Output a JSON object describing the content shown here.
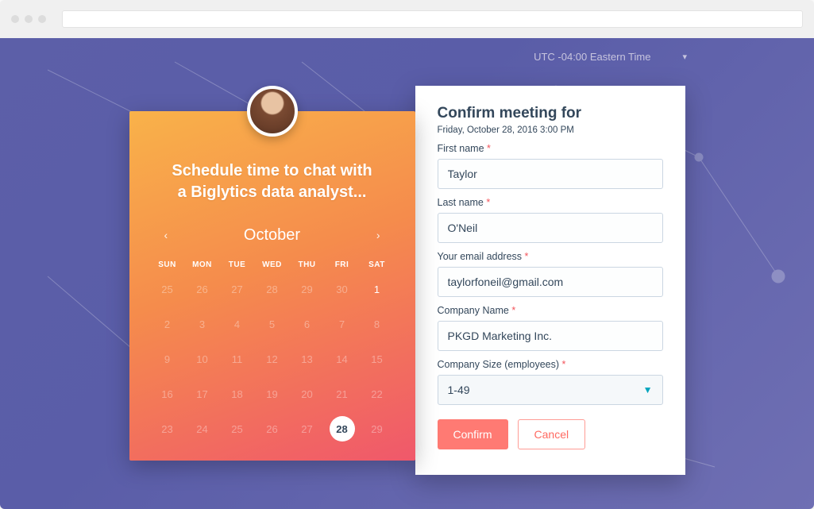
{
  "timezone": {
    "label": "UTC -04:00 Eastern Time"
  },
  "calendar": {
    "title_line1": "Schedule time to chat with",
    "title_line2": "a Biglytics data analyst...",
    "month": "October",
    "dow": [
      "SUN",
      "MON",
      "TUE",
      "WED",
      "THU",
      "FRI",
      "SAT"
    ],
    "selected_day": "28",
    "weeks": [
      [
        {
          "n": "25",
          "dim": true
        },
        {
          "n": "26",
          "dim": true
        },
        {
          "n": "27",
          "dim": true
        },
        {
          "n": "28",
          "dim": true
        },
        {
          "n": "29",
          "dim": true
        },
        {
          "n": "30",
          "dim": true
        },
        {
          "n": "1",
          "dim": false
        }
      ],
      [
        {
          "n": "2",
          "dim": true
        },
        {
          "n": "3",
          "dim": true
        },
        {
          "n": "4",
          "dim": true
        },
        {
          "n": "5",
          "dim": true
        },
        {
          "n": "6",
          "dim": true
        },
        {
          "n": "7",
          "dim": true
        },
        {
          "n": "8",
          "dim": true
        }
      ],
      [
        {
          "n": "9",
          "dim": true
        },
        {
          "n": "10",
          "dim": true
        },
        {
          "n": "11",
          "dim": true
        },
        {
          "n": "12",
          "dim": true
        },
        {
          "n": "13",
          "dim": true
        },
        {
          "n": "14",
          "dim": true
        },
        {
          "n": "15",
          "dim": true
        }
      ],
      [
        {
          "n": "16",
          "dim": true
        },
        {
          "n": "17",
          "dim": true
        },
        {
          "n": "18",
          "dim": true
        },
        {
          "n": "19",
          "dim": true
        },
        {
          "n": "20",
          "dim": true
        },
        {
          "n": "21",
          "dim": true
        },
        {
          "n": "22",
          "dim": true
        }
      ],
      [
        {
          "n": "23",
          "dim": true
        },
        {
          "n": "24",
          "dim": true
        },
        {
          "n": "25",
          "dim": true
        },
        {
          "n": "26",
          "dim": true
        },
        {
          "n": "27",
          "dim": true
        },
        {
          "n": "28",
          "dim": false,
          "sel": true
        },
        {
          "n": "29",
          "dim": true
        }
      ]
    ]
  },
  "form": {
    "heading": "Confirm meeting for",
    "subdate": "Friday, October 28, 2016 3:00 PM",
    "fields": {
      "first_name": {
        "label": "First name",
        "value": "Taylor"
      },
      "last_name": {
        "label": "Last name",
        "value": "O'Neil"
      },
      "email": {
        "label": "Your email address",
        "value": "taylorfoneil@gmail.com"
      },
      "company": {
        "label": "Company Name",
        "value": "PKGD Marketing Inc."
      },
      "size": {
        "label": "Company Size (employees)",
        "value": "1-49"
      }
    },
    "required_mark": "*",
    "buttons": {
      "confirm": "Confirm",
      "cancel": "Cancel"
    }
  }
}
